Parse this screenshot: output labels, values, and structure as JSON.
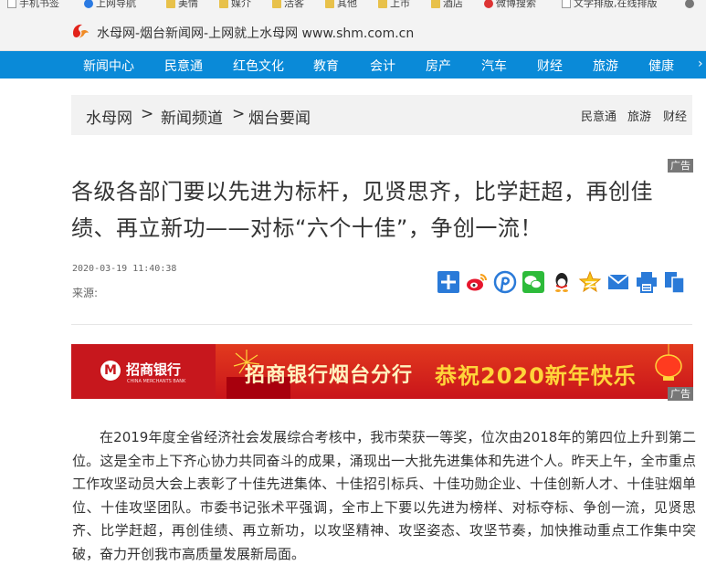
{
  "bookmarks": [
    {
      "label": "手机书签",
      "icon": "page-icon"
    },
    {
      "label": "上网导航",
      "icon": "browser-icon"
    },
    {
      "label": "美情",
      "icon": "folder-icon"
    },
    {
      "label": "媒介",
      "icon": "folder-icon"
    },
    {
      "label": "活客",
      "icon": "folder-icon"
    },
    {
      "label": "其他",
      "icon": "folder-icon"
    },
    {
      "label": "上市",
      "icon": "folder-icon"
    },
    {
      "label": "酒店",
      "icon": "folder-icon"
    },
    {
      "label": "微博搜索",
      "icon": "weibo-icon"
    },
    {
      "label": "文学排版,在线排版",
      "icon": "page-icon"
    }
  ],
  "header": {
    "site_title": "水母网-烟台新闻网-上网就上水母网 www.shm.com.cn"
  },
  "nav": {
    "items": [
      "新闻中心",
      "民意通",
      "红色文化",
      "教育",
      "会计",
      "房产",
      "汽车",
      "财经",
      "旅游",
      "健康"
    ]
  },
  "breadcrumb": {
    "items": [
      "水母网",
      "新闻频道",
      "烟台要闻"
    ],
    "separator": ">",
    "quick_links": [
      "民意通",
      "旅游",
      "财经"
    ]
  },
  "ad_label": "广告",
  "article": {
    "title": "各级各部门要以先进为标杆，见贤思齐，比学赶超，再创佳绩、再立新功——对标“六个十佳”，争创一流！",
    "date": "2020-03-19 11:40:38",
    "source": "来源:",
    "body": "在2019年度全省经济社会发展综合考核中，我市荣获一等奖，位次由2018年的第四位上升到第二位。这是全市上下齐心协力共同奋斗的成果，涌现出一大批先进集体和先进个人。昨天上午，全市重点工作攻坚动员大会上表彰了十佳先进集体、十佳招引标兵、十佳功勋企业、十佳创新人才、十佳驻烟单位、十佳攻坚团队。市委书记张术平强调，全市上下要以先进为榜样、对标夺标、争创一流，见贤思齐、比学赶超，再创佳绩、再立新功，以攻坚精神、攻坚姿态、攻坚节奏，加快推动重点工作集中突破，奋力开创我市高质量发展新局面。"
  },
  "share": {
    "icons": [
      "share-plus-icon",
      "weibo-icon",
      "pinterest-icon",
      "wechat-icon",
      "qq-icon",
      "qzone-icon",
      "email-icon",
      "print-icon",
      "copy-icon"
    ]
  },
  "banner": {
    "bank_name": "招商银行",
    "bank_name_en": "CHINA MERCHANTS BANK",
    "text1": "招商银行烟台分行",
    "text2": "恭祝2020新年快乐"
  },
  "colors": {
    "nav_bg": "#0a8ad8",
    "banner_red": "#c7171d",
    "banner_gold": "#ffd43a"
  }
}
